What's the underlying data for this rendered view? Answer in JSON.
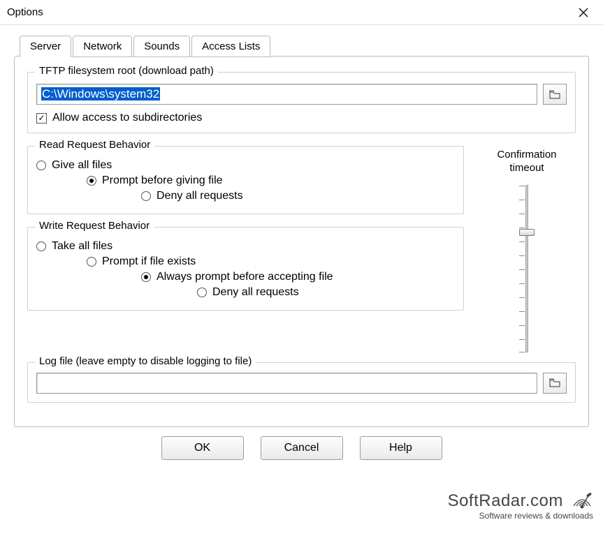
{
  "window": {
    "title": "Options"
  },
  "tabs": {
    "items": [
      {
        "label": "Server",
        "active": true
      },
      {
        "label": "Network",
        "active": false
      },
      {
        "label": "Sounds",
        "active": false
      },
      {
        "label": "Access Lists",
        "active": false
      }
    ]
  },
  "fsroot": {
    "legend": "TFTP filesystem root (download path)",
    "path_value": "C:\\Windows\\system32",
    "path_highlighted": true,
    "browse_icon": "folder-icon",
    "allow_subdirs_label": "Allow access to subdirectories",
    "allow_subdirs_checked": true
  },
  "read_behavior": {
    "legend": "Read Request Behavior",
    "options": [
      {
        "label": "Give all files",
        "selected": false,
        "indent": 0
      },
      {
        "label": "Prompt before giving file",
        "selected": true,
        "indent": 1
      },
      {
        "label": "Deny all requests",
        "selected": false,
        "indent": 2
      }
    ]
  },
  "write_behavior": {
    "legend": "Write Request Behavior",
    "options": [
      {
        "label": "Take all files",
        "selected": false,
        "indent": 0
      },
      {
        "label": "Prompt if file exists",
        "selected": false,
        "indent": 1
      },
      {
        "label": "Always prompt before accepting file",
        "selected": true,
        "indent": 2
      },
      {
        "label": "Deny all requests",
        "selected": false,
        "indent": 3
      }
    ]
  },
  "confirmation_timeout": {
    "label_line1": "Confirmation",
    "label_line2": "timeout",
    "value_fraction": 0.28
  },
  "logfile": {
    "legend": "Log file (leave empty to disable logging to file)",
    "value": "",
    "browse_icon": "folder-icon"
  },
  "buttons": {
    "ok": "OK",
    "cancel": "Cancel",
    "help": "Help"
  },
  "watermark": {
    "brand": "SoftRadar.com",
    "tagline": "Software reviews & downloads"
  }
}
